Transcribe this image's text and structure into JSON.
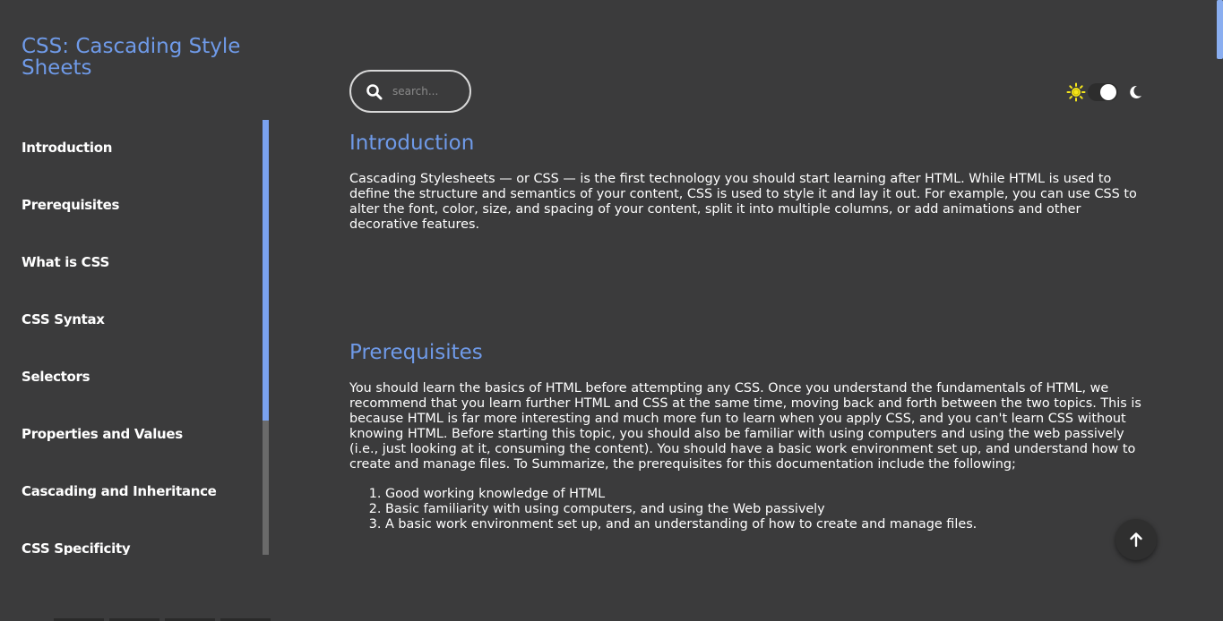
{
  "sidebar": {
    "title": "CSS: Cascading Style Sheets",
    "items": [
      {
        "label": "Introduction"
      },
      {
        "label": "Prerequisites"
      },
      {
        "label": "What is CSS"
      },
      {
        "label": "CSS Syntax"
      },
      {
        "label": "Selectors"
      },
      {
        "label": "Properties and Values"
      },
      {
        "label": "Cascading and Inheritance"
      },
      {
        "label": "CSS Specificity"
      }
    ]
  },
  "search": {
    "placeholder": "search...",
    "value": "",
    "icon": "search-icon"
  },
  "theme": {
    "sun_icon": "sun-icon",
    "moon_icon": "moon-icon",
    "mode": "dark"
  },
  "sections": {
    "introduction": {
      "heading": "Introduction",
      "text": "Cascading Stylesheets — or CSS — is the first technology you should start learning after HTML. While HTML is used to define the structure and semantics of your content, CSS is used to style it and lay it out. For example, you can use CSS to alter the font, color, size, and spacing of your content, split it into multiple columns, or add animations and other decorative features."
    },
    "prerequisites": {
      "heading": "Prerequisites",
      "text": "You should learn the basics of HTML before attempting any CSS. Once you understand the fundamentals of HTML, we recommend that you learn further HTML and CSS at the same time, moving back and forth between the two topics. This is because HTML is far more interesting and much more fun to learn when you apply CSS, and you can't learn CSS without knowing HTML. Before starting this topic, you should also be familiar with using computers and using the web passively (i.e., just looking at it, consuming the content). You should have a basic work environment set up, and understand how to create and manage files. To Summarize, the prerequisites for this documentation include the following;",
      "list": [
        "Good working knowledge of HTML",
        "Basic familiarity with using computers, and using the Web passively",
        "A basic work environment set up, and an understanding of how to create and manage files."
      ]
    }
  },
  "colors": {
    "background": "#3b3b3c",
    "accent": "#6f9ae8",
    "text": "#ffffff",
    "sun": "#f5e61c"
  }
}
